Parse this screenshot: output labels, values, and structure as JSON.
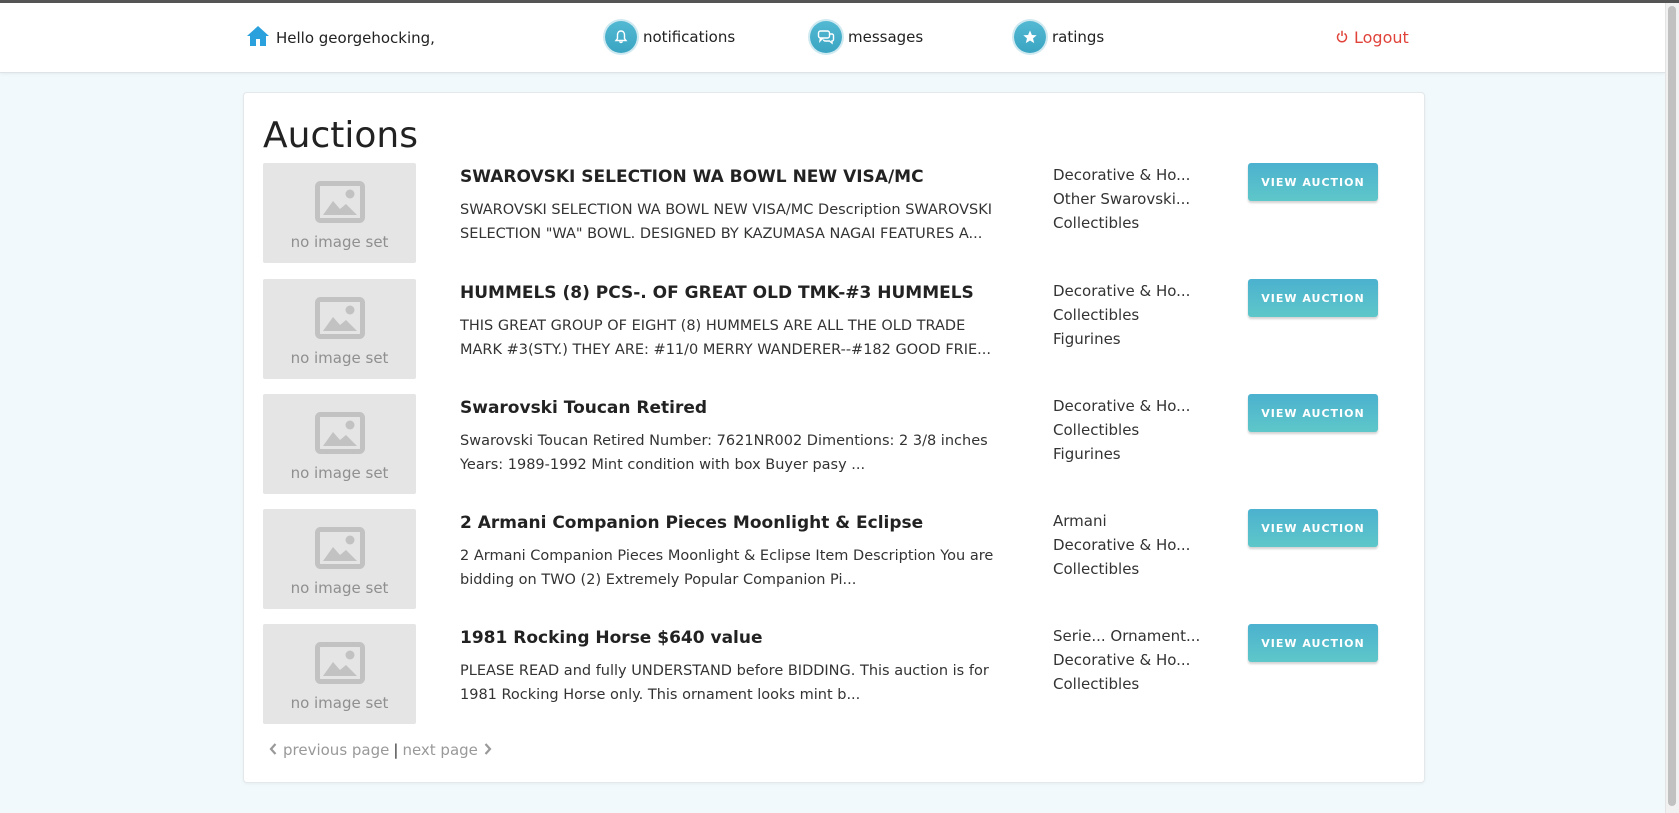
{
  "header": {
    "greeting": "Hello georgehocking,",
    "notifications_label": "notifications",
    "messages_label": "messages",
    "ratings_label": "ratings",
    "logout_label": "Logout"
  },
  "page": {
    "title": "Auctions"
  },
  "auctions": [
    {
      "image_text": "no image set",
      "title": "SWAROVSKI SELECTION WA BOWL NEW VISA/MC",
      "description": "SWAROVSKI SELECTION WA BOWL NEW VISA/MC Description SWAROVSKI SELECTION \"WA\" BOWL. DESIGNED BY KAZUMASA NAGAI FEATURES A...",
      "categories": [
        "Decorative & Ho...",
        "Other Swarovski...",
        "Collectibles"
      ],
      "button": "VIEW AUCTION"
    },
    {
      "image_text": "no image set",
      "title": "HUMMELS (8) PCS-. OF GREAT OLD TMK-#3 HUMMELS",
      "description": "THIS GREAT GROUP OF EIGHT (8) HUMMELS ARE ALL THE OLD TRADE MARK #3(STY.) THEY ARE: #11/0 MERRY WANDERER--#182 GOOD FRIE...",
      "categories": [
        "Decorative & Ho...",
        "Collectibles",
        "Figurines"
      ],
      "button": "VIEW AUCTION"
    },
    {
      "image_text": "no image set",
      "title": "Swarovski Toucan Retired",
      "description": "Swarovski Toucan Retired Number: 7621NR002 Dimentions: 2 3/8 inches Years: 1989-1992 Mint condition with box Buyer pasy ...",
      "categories": [
        "Decorative & Ho...",
        "Collectibles",
        "Figurines"
      ],
      "button": "VIEW AUCTION"
    },
    {
      "image_text": "no image set",
      "title": "2 Armani Companion Pieces Moonlight & Eclipse",
      "description": "2 Armani Companion Pieces Moonlight & Eclipse Item Description You are bidding on TWO (2) Extremely Popular Companion Pi...",
      "categories": [
        "Armani",
        "Decorative & Ho...",
        "Collectibles"
      ],
      "button": "VIEW AUCTION"
    },
    {
      "image_text": "no image set",
      "title": "1981 Rocking Horse $640 value",
      "description": "PLEASE READ and fully UNDERSTAND before BIDDING. This auction is for 1981 Rocking Horse only. This ornament looks mint b...",
      "categories": [
        "Serie... Ornament...",
        "Decorative & Ho...",
        "Collectibles"
      ],
      "button": "VIEW AUCTION"
    }
  ],
  "pagination": {
    "previous_label": "previous page",
    "separator": "|",
    "next_label": "next page"
  },
  "colors": {
    "accent": "#4bb1cf",
    "logout": "#e0433a",
    "background": "#f1f9fc"
  }
}
